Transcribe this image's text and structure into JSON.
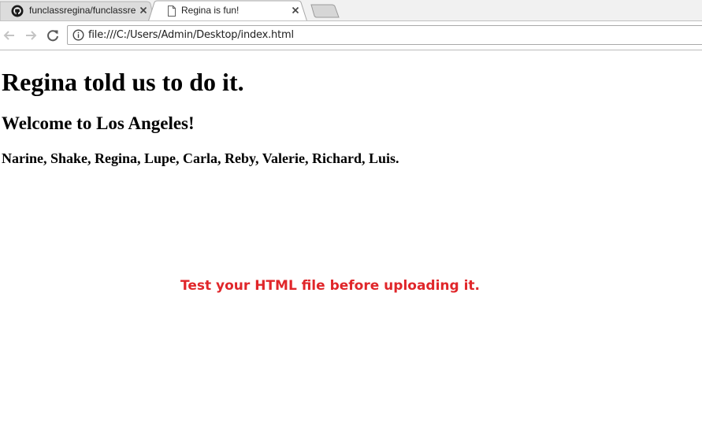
{
  "browser": {
    "tabs": [
      {
        "title": "funclassregina/funclassre",
        "favicon": "github-icon",
        "active": false
      },
      {
        "title": "Regina is fun!",
        "favicon": "page-icon",
        "active": true
      }
    ],
    "address_bar": {
      "url": "file:///C:/Users/Admin/Desktop/index.html",
      "info_icon": "info-icon"
    },
    "toolbar": {
      "back_icon": "back-arrow-icon",
      "forward_icon": "forward-arrow-icon",
      "reload_icon": "reload-icon"
    }
  },
  "page": {
    "heading1": "Regina told us to do it.",
    "heading2": "Welcome to Los Angeles!",
    "heading3": "Narine, Shake, Regina, Lupe, Carla, Reby, Valerie, Richard, Luis."
  },
  "overlay": {
    "notice": "Test your HTML file before uploading it.",
    "notice_color": "#e0262a"
  }
}
